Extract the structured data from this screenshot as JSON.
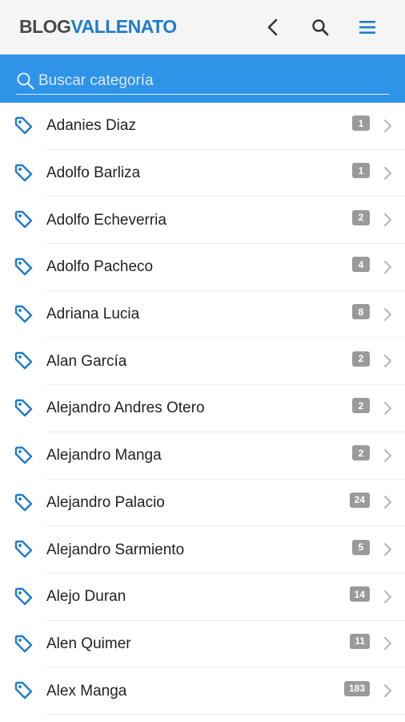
{
  "header": {
    "logo_part1": "BLOG",
    "logo_part2": "VALLENATO",
    "icons": [
      "back-chevron-icon",
      "search-icon",
      "menu-icon"
    ]
  },
  "search": {
    "placeholder": "Buscar categoría",
    "value": ""
  },
  "colors": {
    "brand_blue": "#1e7ccd",
    "search_bar": "#2f93e8",
    "badge": "#9a9a9a"
  },
  "categories": [
    {
      "name": "Adanies Diaz",
      "count": "1"
    },
    {
      "name": "Adolfo Barliza",
      "count": "1"
    },
    {
      "name": "Adolfo Echeverria",
      "count": "2"
    },
    {
      "name": "Adolfo Pacheco",
      "count": "4"
    },
    {
      "name": "Adriana Lucia",
      "count": "8"
    },
    {
      "name": "Alan García",
      "count": "2"
    },
    {
      "name": "Alejandro Andres Otero",
      "count": "2"
    },
    {
      "name": "Alejandro Manga",
      "count": "2"
    },
    {
      "name": "Alejandro Palacio",
      "count": "24"
    },
    {
      "name": "Alejandro Sarmiento",
      "count": "5"
    },
    {
      "name": "Alejo Duran",
      "count": "14"
    },
    {
      "name": "Alen Quimer",
      "count": "11"
    },
    {
      "name": "Alex Manga",
      "count": "183"
    }
  ]
}
